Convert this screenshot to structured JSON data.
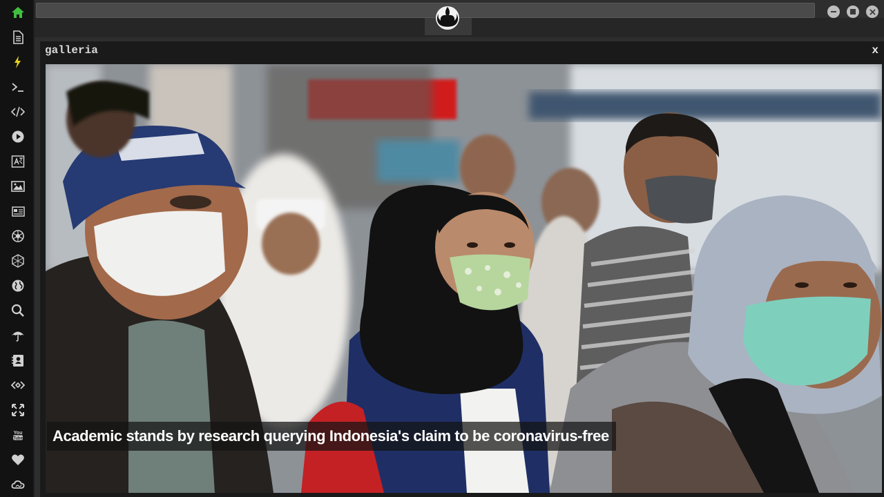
{
  "dock": {
    "items": [
      {
        "name": "home-icon",
        "color": "#3fbf3f"
      },
      {
        "name": "document-icon",
        "color": "#d0d0d0"
      },
      {
        "name": "lightning-icon",
        "color": "#e8d21d"
      },
      {
        "name": "terminal-icon",
        "color": "#d0d0d0"
      },
      {
        "name": "code-icon",
        "color": "#d0d0d0"
      },
      {
        "name": "play-icon",
        "color": "#d0d0d0"
      },
      {
        "name": "translate-icon",
        "color": "#d0d0d0"
      },
      {
        "name": "image-icon",
        "color": "#d0d0d0"
      },
      {
        "name": "newspaper-icon",
        "color": "#d0d0d0"
      },
      {
        "name": "galactic-icon",
        "color": "#d0d0d0"
      },
      {
        "name": "hexagon-icon",
        "color": "#d0d0d0"
      },
      {
        "name": "globe-icon",
        "color": "#d0d0d0"
      },
      {
        "name": "search-icon",
        "color": "#d0d0d0"
      },
      {
        "name": "umbrella-icon",
        "color": "#d0d0d0"
      },
      {
        "name": "contact-card-icon",
        "color": "#d0d0d0"
      },
      {
        "name": "link-icon",
        "color": "#d0d0d0"
      },
      {
        "name": "expand-icon",
        "color": "#d0d0d0"
      },
      {
        "name": "youtube-icon",
        "color": "#d0d0d0"
      },
      {
        "name": "heart-icon",
        "color": "#d0d0d0"
      },
      {
        "name": "cloud-icon",
        "color": "#d0d0d0"
      }
    ]
  },
  "window": {
    "title": "galleria",
    "close_label": "x"
  },
  "gallery": {
    "caption": "Academic stands by research querying Indonesia's claim to be coronavirus-free"
  },
  "colors": {
    "accent_green": "#3fbf3f",
    "accent_yellow": "#e8d21d",
    "background": "#2e2e2e"
  }
}
